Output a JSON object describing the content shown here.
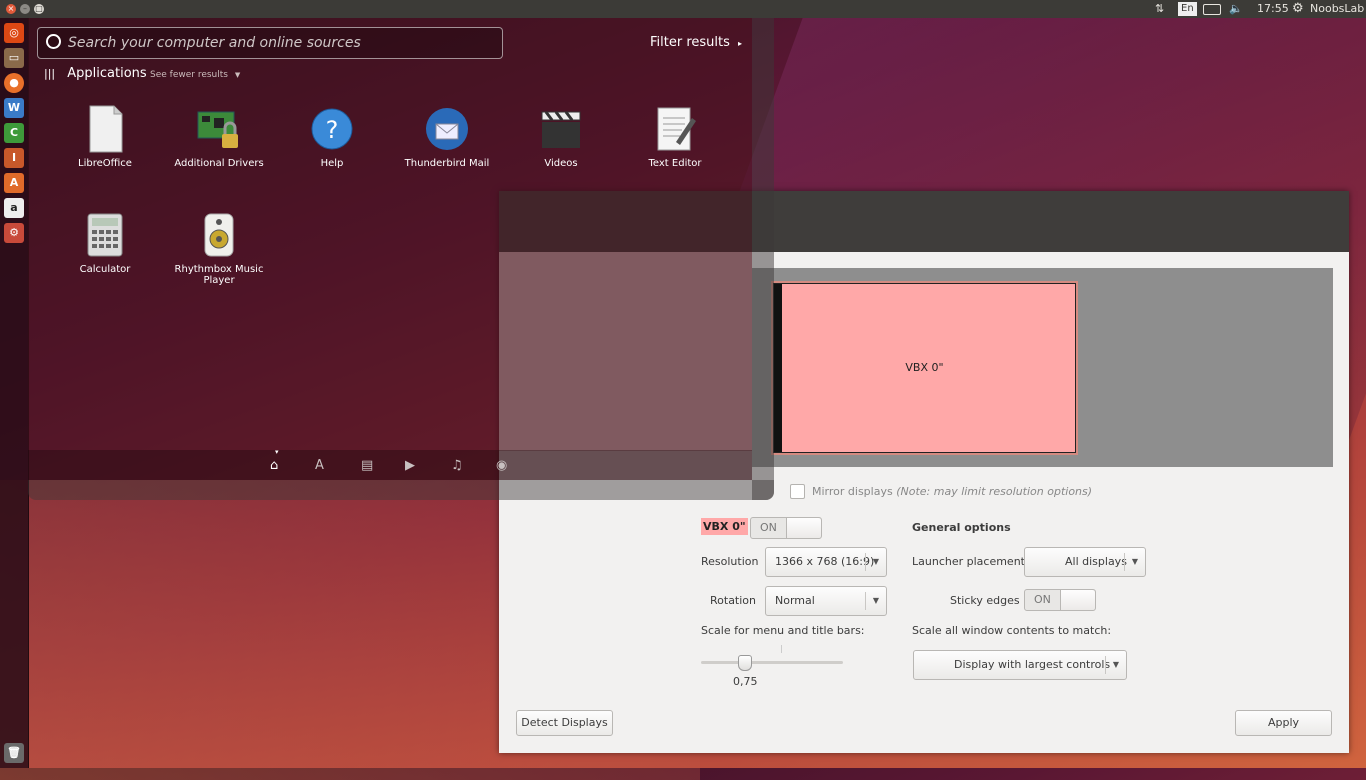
{
  "top_panel": {
    "keyboard_layout": "En",
    "clock": "17:55",
    "user": "NoobsLab",
    "icons": [
      "network-icon",
      "keyboard-icon",
      "battery-icon",
      "volume-icon",
      "gear-icon"
    ]
  },
  "launcher": {
    "items": [
      "ubuntu-dash",
      "files",
      "firefox",
      "libreoffice-writer",
      "libreoffice-calc",
      "libreoffice-impress",
      "software-center",
      "amazon",
      "system-settings",
      "trash"
    ]
  },
  "dash": {
    "search_placeholder": "Search your computer and online sources",
    "filter_label": "Filter results",
    "category_title": "Applications",
    "see_fewer": "See fewer results",
    "apps": [
      {
        "label": "LibreOffice",
        "icon": "libreoffice-icon"
      },
      {
        "label": "Additional Drivers",
        "icon": "drivers-icon"
      },
      {
        "label": "Help",
        "icon": "help-icon"
      },
      {
        "label": "Thunderbird Mail",
        "icon": "thunderbird-icon"
      },
      {
        "label": "Videos",
        "icon": "videos-icon"
      },
      {
        "label": "Text Editor",
        "icon": "text-editor-icon"
      },
      {
        "label": "Calculator",
        "icon": "calculator-icon"
      },
      {
        "label": "Rhythmbox Music Player",
        "icon": "rhythmbox-icon"
      }
    ],
    "lenses": [
      "home-lens-icon",
      "applications-lens-icon",
      "files-lens-icon",
      "video-lens-icon",
      "music-lens-icon",
      "photo-lens-icon"
    ]
  },
  "display": {
    "monitor_label": "VBX 0\"",
    "mirror_label": "Mirror displays",
    "mirror_note": "(Note: may limit resolution options)",
    "selected_monitor": "VBX 0\"",
    "monitor_toggle": "ON",
    "resolution_label": "Resolution",
    "resolution_value": "1366 x 768 (16:9)",
    "rotation_label": "Rotation",
    "rotation_value": "Normal",
    "scale_label": "Scale for menu and title bars:",
    "scale_value": "0,75",
    "scale_fraction": 0.3,
    "general_title": "General options",
    "launcher_placement_label": "Launcher placement",
    "launcher_placement_value": "All displays",
    "sticky_label": "Sticky edges",
    "sticky_toggle": "ON",
    "scale_all_label": "Scale all window contents to match:",
    "scale_all_value": "Display with largest controls",
    "detect_button": "Detect Displays",
    "apply_button": "Apply"
  }
}
